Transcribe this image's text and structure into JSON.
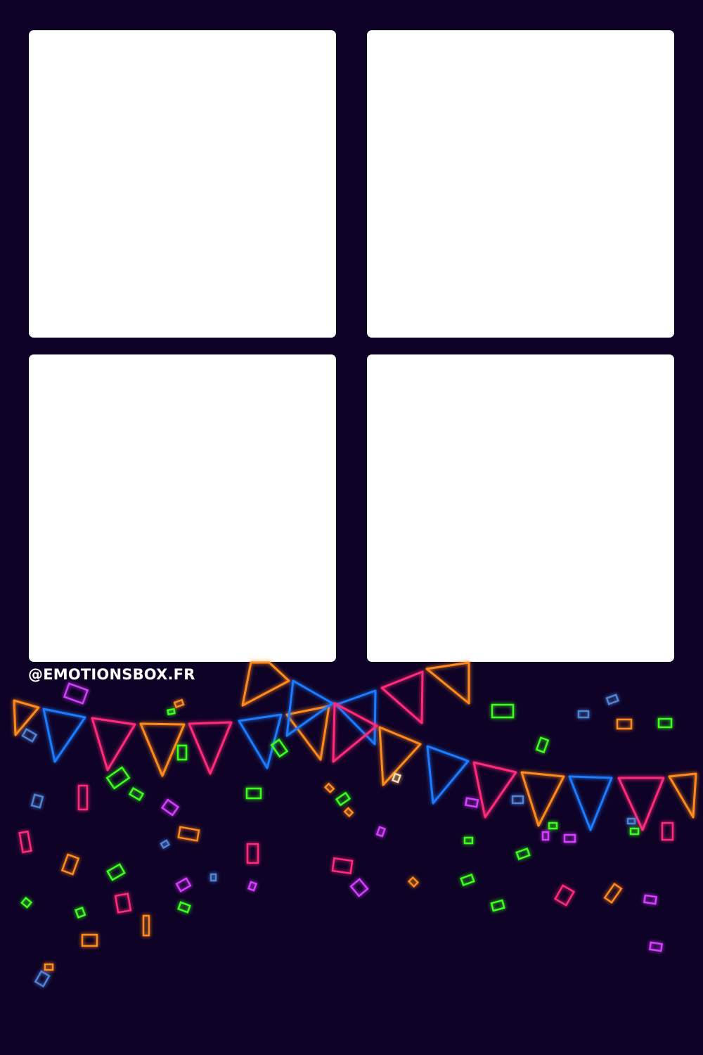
{
  "background_color": "#0e0226",
  "slot_color": "#ffffff",
  "photo_slots": [
    {
      "name": "photo-slot-1"
    },
    {
      "name": "photo-slot-2"
    },
    {
      "name": "photo-slot-3"
    },
    {
      "name": "photo-slot-4"
    }
  ],
  "brand": {
    "text": "@EMOTIONSBOX.FR"
  },
  "decoration": {
    "theme": "neon bunting garland with confetti",
    "palette": {
      "orange": "#ff8a1d",
      "blue": "#1f7bff",
      "pink": "#ff2b7a",
      "green": "#3dff1c",
      "purple": "#d53cff",
      "steel_blue": "#4f83d6"
    }
  }
}
